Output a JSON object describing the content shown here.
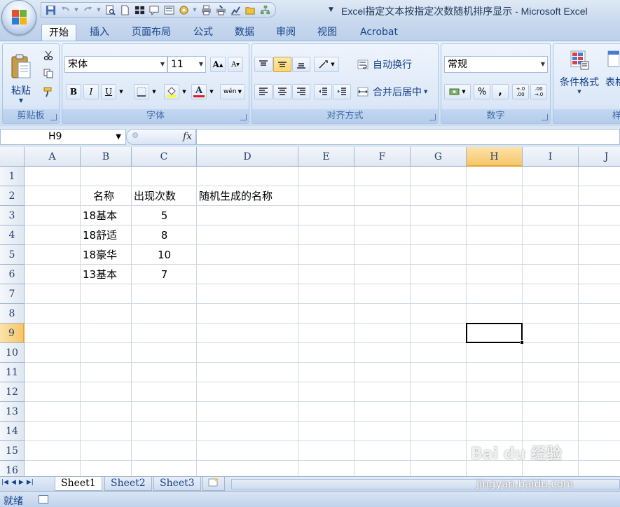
{
  "window": {
    "title": "Excel指定文本按指定次数随机排序显示 - Microsoft Excel"
  },
  "quick_access": [
    "save-icon",
    "undo-icon",
    "redo-icon",
    "print-preview-icon",
    "new-icon",
    "table-icon",
    "comment-icon",
    "form-icon",
    "macro-icon",
    "print-icon",
    "quick-print-icon",
    "chart-icon",
    "open-icon",
    "diagram-icon"
  ],
  "tabs": [
    "开始",
    "插入",
    "页面布局",
    "公式",
    "数据",
    "审阅",
    "视图",
    "Acrobat"
  ],
  "ribbon": {
    "clipboard": {
      "paste": "粘贴",
      "label": "剪贴板"
    },
    "font": {
      "name": "宋体",
      "size": "11",
      "grow": "A",
      "shrink": "A",
      "bold": "B",
      "italic": "I",
      "underline": "U",
      "font_color_glyph": "A",
      "phonetic": "wén",
      "label": "字体"
    },
    "alignment": {
      "wrap": "自动换行",
      "merge": "合并后居中",
      "label": "对齐方式"
    },
    "number": {
      "format": "常规",
      "percent": "%",
      "comma": ",",
      "inc_decimal": "+.0 .00",
      "dec_decimal": ".00 →.0",
      "label": "数字"
    },
    "styles": {
      "conditional": "条件格式",
      "table_partial": "表格",
      "label_partial": "样"
    }
  },
  "formula_bar": {
    "name_box": "H9",
    "fx": "fx",
    "value": ""
  },
  "columns": [
    "A",
    "B",
    "C",
    "D",
    "E",
    "F",
    "G",
    "H",
    "I",
    "J"
  ],
  "rows": [
    "1",
    "2",
    "3",
    "4",
    "5",
    "6",
    "7",
    "8",
    "9",
    "10",
    "11",
    "12",
    "13",
    "14",
    "15",
    "16"
  ],
  "selected_cell": "H9",
  "cells": {
    "B2": "名称",
    "C2": "出现次数",
    "D2": "随机生成的名称",
    "B3": "18基本",
    "C3": "5",
    "B4": "18舒适",
    "C4": "8",
    "B5": "18豪华",
    "C5": "10",
    "B6": "13基本",
    "C6": "7"
  },
  "sheets": [
    "Sheet1",
    "Sheet2",
    "Sheet3"
  ],
  "active_sheet": "Sheet1",
  "status": "就绪",
  "watermark": {
    "logo": "Bai du 经验",
    "url": "jingyan.baidu.com"
  },
  "colors": {
    "accent": "#15428b",
    "selection_header": "#f6c66a",
    "grid_line": "#d0d7e5"
  }
}
